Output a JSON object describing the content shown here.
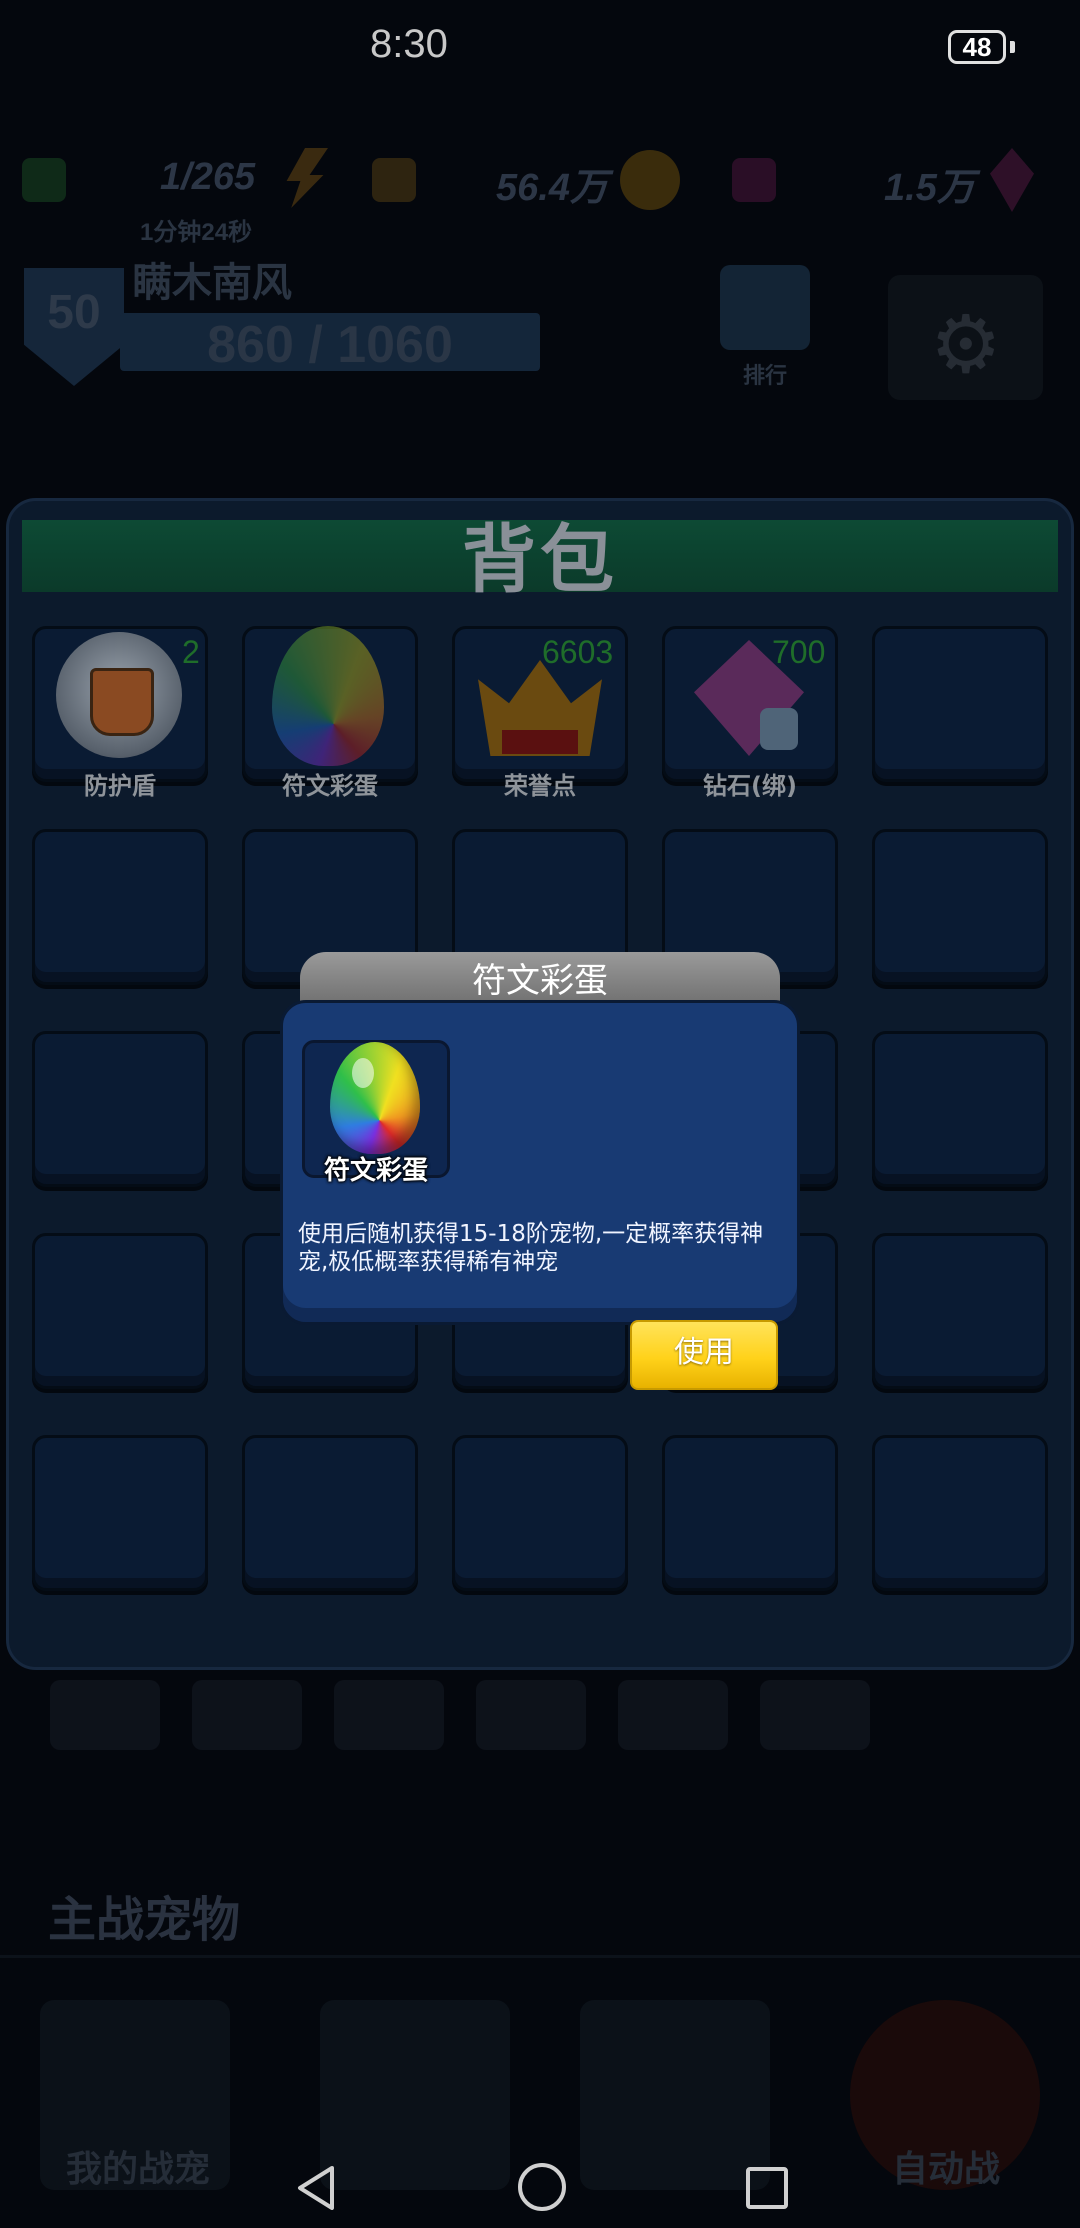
{
  "status_bar": {
    "time": "8:30",
    "battery": "48"
  },
  "hud": {
    "energy": "1/265",
    "gold": "56.4万",
    "gems": "1.5万",
    "timer": "1分钟24秒",
    "player_name": "瞒木南风",
    "level": "50",
    "xp": "860 / 1060",
    "mid_button_label": "排行"
  },
  "bag": {
    "title": "背包",
    "items": [
      {
        "label": "防护盾",
        "count": "2",
        "icon": "shield-icon"
      },
      {
        "label": "符文彩蛋",
        "count": "",
        "icon": "rainbow-egg-icon"
      },
      {
        "label": "荣誉点",
        "count": "6603",
        "icon": "crown-icon"
      },
      {
        "label": "钻石(绑)",
        "count": "700",
        "icon": "locked-diamond-icon"
      }
    ]
  },
  "dialog": {
    "title": "符文彩蛋",
    "item_label": "符文彩蛋",
    "description": "使用后随机获得15-18阶宠物,一定概率获得神宠,极低概率获得稀有神宠",
    "use_button": "使用"
  },
  "bottom": {
    "section_title": "主战宠物",
    "tabs": [
      "我的战宠",
      "",
      "",
      "自动战"
    ]
  }
}
